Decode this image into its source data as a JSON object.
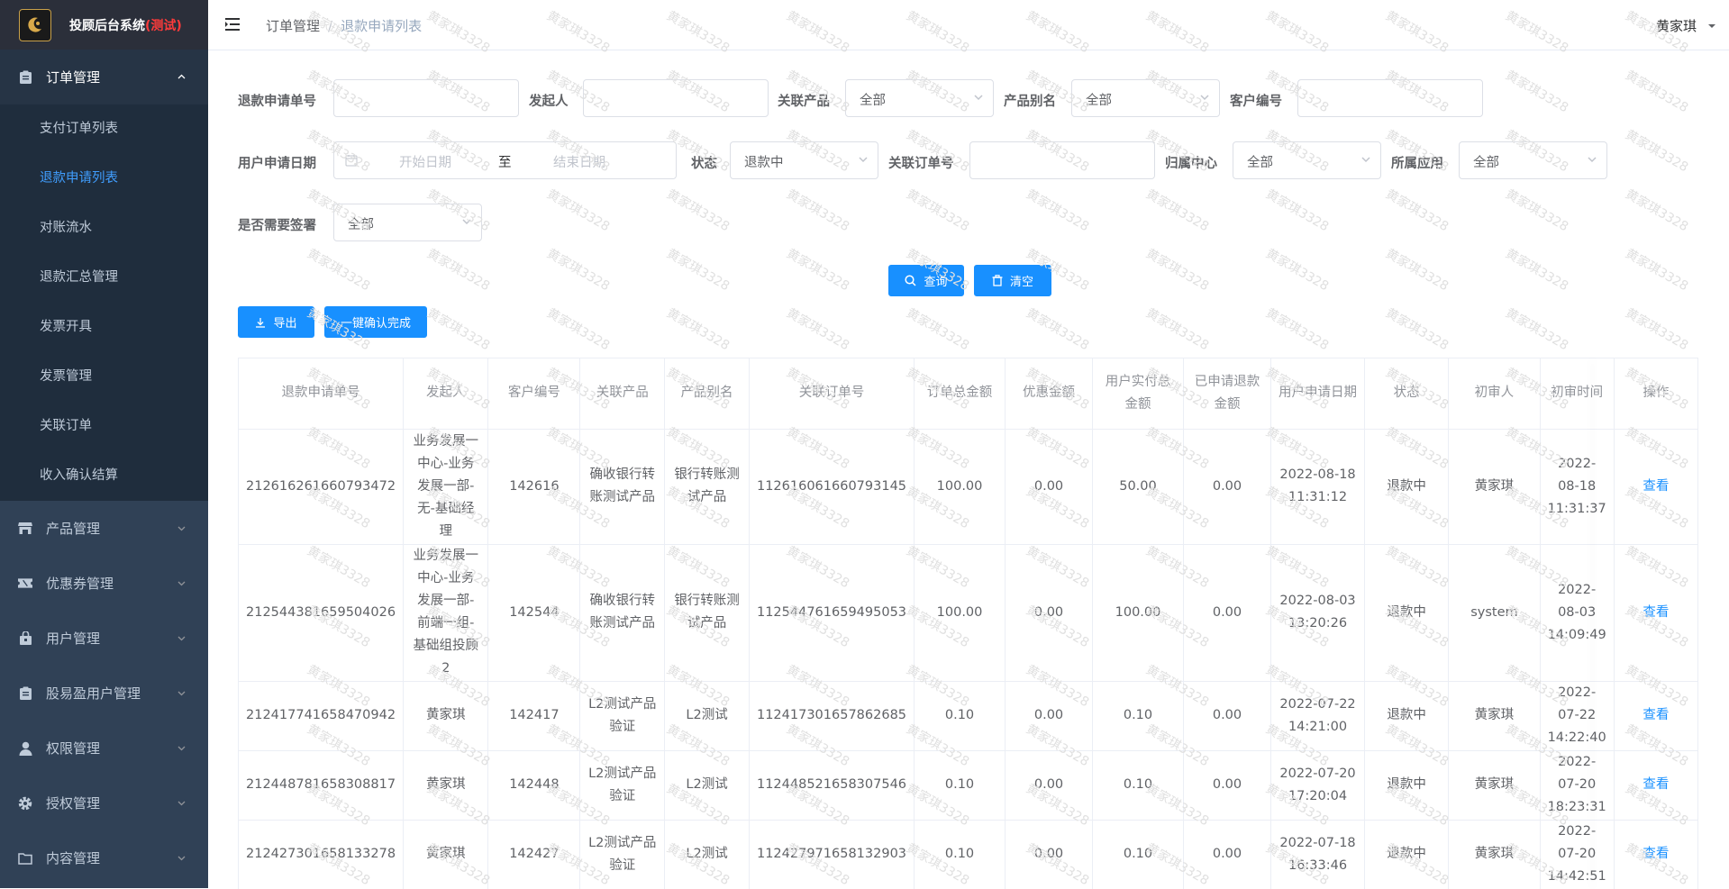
{
  "app": {
    "title": "投顾后台系统",
    "title_suffix": "(测试)"
  },
  "sidebar": {
    "groups": [
      {
        "label": "订单管理",
        "icon": "clipboard-icon",
        "open": true,
        "items": [
          "支付订单列表",
          "退款申请列表",
          "对账流水",
          "退款汇总管理",
          "发票开具",
          "发票管理",
          "关联订单",
          "收入确认结算"
        ],
        "active_index": 1
      },
      {
        "label": "产品管理",
        "icon": "store-icon"
      },
      {
        "label": "优惠券管理",
        "icon": "ticket-icon"
      },
      {
        "label": "用户管理",
        "icon": "bag-icon"
      },
      {
        "label": "股易盈用户管理",
        "icon": "clipboard-icon"
      },
      {
        "label": "权限管理",
        "icon": "user-icon"
      },
      {
        "label": "授权管理",
        "icon": "gear-icon"
      },
      {
        "label": "内容管理",
        "icon": "folder-icon"
      }
    ]
  },
  "header": {
    "breadcrumb": [
      "订单管理",
      "退款申请列表"
    ],
    "user": "黄家琪"
  },
  "filters": {
    "refund_no": {
      "label": "退款申请单号",
      "value": ""
    },
    "initiator": {
      "label": "发起人",
      "value": ""
    },
    "product": {
      "label": "关联产品",
      "value": "全部"
    },
    "product_alias": {
      "label": "产品别名",
      "value": "全部"
    },
    "customer_no": {
      "label": "客户编号",
      "value": ""
    },
    "apply_date": {
      "label": "用户申请日期",
      "start_placeholder": "开始日期",
      "separator": "至",
      "end_placeholder": "结束日期"
    },
    "status": {
      "label": "状态",
      "value": "退款中"
    },
    "order_no": {
      "label": "关联订单号",
      "value": ""
    },
    "center": {
      "label": "归属中心",
      "value": "全部"
    },
    "app": {
      "label": "所属应用",
      "value": "全部"
    },
    "need_sign": {
      "label": "是否需要签署",
      "value": "全部"
    }
  },
  "buttons": {
    "search": "查询",
    "clear": "清空",
    "export": "导出",
    "confirm_all": "一键确认完成"
  },
  "table": {
    "columns": [
      "退款申请单号",
      "发起人",
      "客户编号",
      "关联产品",
      "产品别名",
      "关联订单号",
      "订单总金额",
      "优惠金额",
      "用户实付总金额",
      "已申请退款金额",
      "用户申请日期",
      "状态",
      "初审人",
      "初审时间",
      "操作"
    ],
    "rows": [
      {
        "refund_no": "212616261660793472",
        "initiator": "业务发展一中心-业务发展一部-无-基础经理",
        "customer": "142616",
        "product": "确收银行转账测试产品",
        "alias": "银行转账测试产品",
        "order_no": "112616061660793145",
        "total": "100.00",
        "discount": "0.00",
        "paid": "50.00",
        "refunded": "0.00",
        "apply_date": "2022-08-18 11:31:12",
        "status": "退款中",
        "reviewer": "黄家琪",
        "review_time": "2022-08-18 11:31:37",
        "action": "查看"
      },
      {
        "refund_no": "212544381659504026",
        "initiator": "业务发展一中心-业务发展一部-前端一组-基础组投顾2",
        "customer": "142544",
        "product": "确收银行转账测试产品",
        "alias": "银行转账测试产品",
        "order_no": "112544761659495053",
        "total": "100.00",
        "discount": "0.00",
        "paid": "100.00",
        "refunded": "0.00",
        "apply_date": "2022-08-03 13:20:26",
        "status": "退款中",
        "reviewer": "system",
        "review_time": "2022-08-03 14:09:49",
        "action": "查看"
      },
      {
        "refund_no": "212417741658470942",
        "initiator": "黄家琪",
        "customer": "142417",
        "product": "L2测试产品验证",
        "alias": "L2测试",
        "order_no": "112417301657862685",
        "total": "0.10",
        "discount": "0.00",
        "paid": "0.10",
        "refunded": "0.00",
        "apply_date": "2022-07-22 14:21:00",
        "status": "退款中",
        "reviewer": "黄家琪",
        "review_time": "2022-07-22 14:22:40",
        "action": "查看"
      },
      {
        "refund_no": "212448781658308817",
        "initiator": "黄家琪",
        "customer": "142448",
        "product": "L2测试产品验证",
        "alias": "L2测试",
        "order_no": "112448521658307546",
        "total": "0.10",
        "discount": "0.00",
        "paid": "0.10",
        "refunded": "0.00",
        "apply_date": "2022-07-20 17:20:04",
        "status": "退款中",
        "reviewer": "黄家琪",
        "review_time": "2022-07-20 18:23:31",
        "action": "查看"
      },
      {
        "refund_no": "212427301658133278",
        "initiator": "黄家琪",
        "customer": "142427",
        "product": "L2测试产品验证",
        "alias": "L2测试",
        "order_no": "112427971658132903",
        "total": "0.10",
        "discount": "0.00",
        "paid": "0.10",
        "refunded": "0.00",
        "apply_date": "2022-07-18 16:33:46",
        "status": "退款中",
        "reviewer": "黄家琪",
        "review_time": "2022-07-20 14:42:51",
        "action": "查看"
      }
    ]
  },
  "watermark": {
    "text": "黄家琪3328",
    "color": "#e0e0e0"
  },
  "colors": {
    "primary": "#1890ff",
    "sidebar": "#304156",
    "sidebar_sub": "#1f2d3d",
    "active": "#409eff"
  }
}
